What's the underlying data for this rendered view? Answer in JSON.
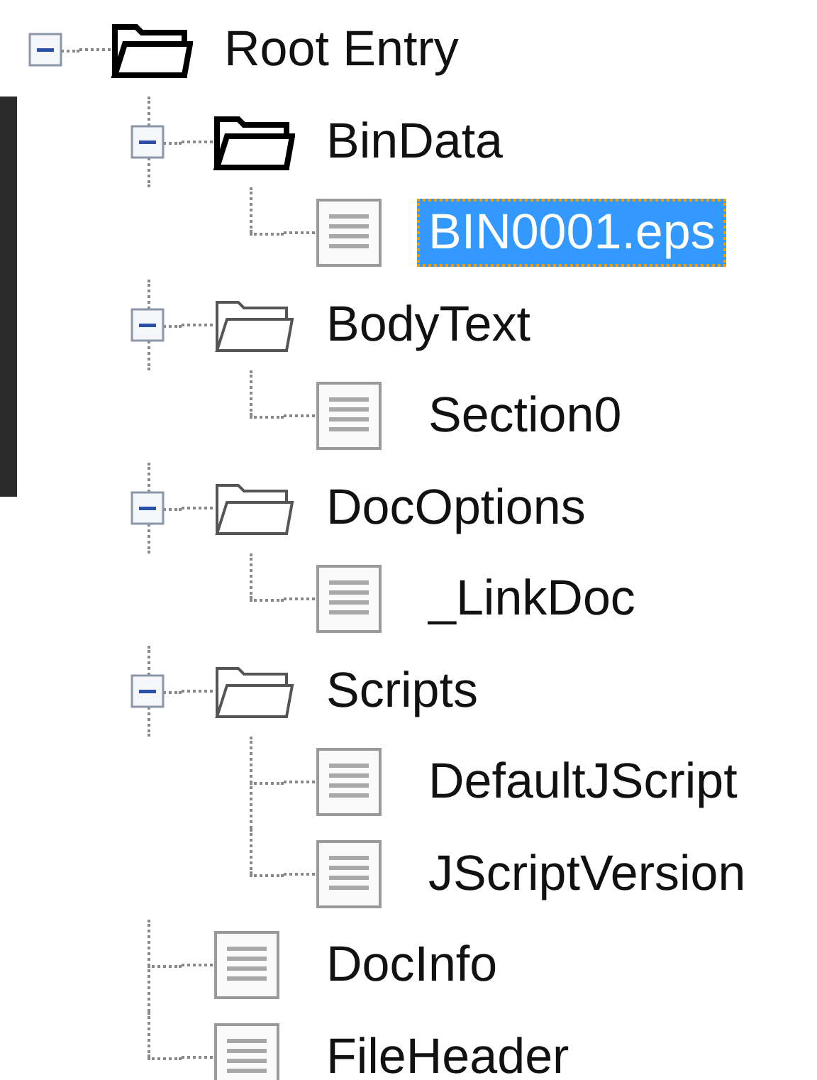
{
  "tree": [
    {
      "label": "Root Entry",
      "kind": "folder",
      "expanded": true,
      "selected": false,
      "children": [
        {
          "label": "BinData",
          "kind": "folder",
          "expanded": true,
          "selected": false,
          "children": [
            {
              "label": "BIN0001.eps",
              "kind": "file",
              "selected": true
            }
          ]
        },
        {
          "label": "BodyText",
          "kind": "folder",
          "expanded": true,
          "selected": false,
          "children": [
            {
              "label": "Section0",
              "kind": "file",
              "selected": false
            }
          ]
        },
        {
          "label": "DocOptions",
          "kind": "folder",
          "expanded": true,
          "selected": false,
          "children": [
            {
              "label": "_LinkDoc",
              "kind": "file",
              "selected": false
            }
          ]
        },
        {
          "label": "Scripts",
          "kind": "folder",
          "expanded": true,
          "selected": false,
          "children": [
            {
              "label": "DefaultJScript",
              "kind": "file",
              "selected": false
            },
            {
              "label": "JScriptVersion",
              "kind": "file",
              "selected": false
            }
          ]
        },
        {
          "label": "DocInfo",
          "kind": "file",
          "selected": false
        },
        {
          "label": "FileHeader",
          "kind": "file",
          "selected": false
        }
      ]
    }
  ]
}
